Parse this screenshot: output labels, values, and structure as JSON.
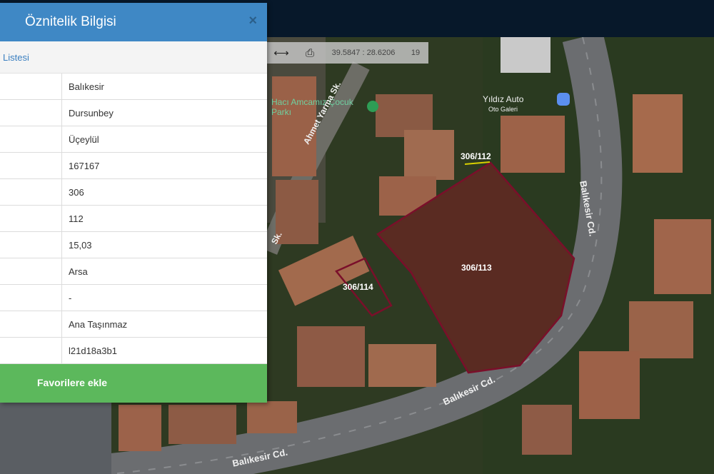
{
  "panel": {
    "title": "Öznitelik Bilgisi",
    "close_symbol": "×",
    "list_link": "Listesi",
    "values": [
      "Balıkesir",
      "Dursunbey",
      "Üçeylül",
      "167167",
      "306",
      "112",
      "15,03",
      "Arsa",
      "-",
      "Ana Taşınmaz",
      "l21d18a3b1"
    ],
    "favorite_button": "Favorilere ekle"
  },
  "toolbar": {
    "measure_icon": "measure-icon",
    "print_icon": "print-icon",
    "coordinates": "39.5847 : 28.6206",
    "zoom": "19"
  },
  "map": {
    "parcels": [
      "306/112",
      "306/113",
      "306/114"
    ],
    "street_labels": [
      "Ahmet Yarma Sk.",
      "Sk.",
      "Balıkesir Cd.",
      "Balıkesir Cd.",
      "Balıkesir Cd."
    ],
    "poi_labels": [
      "Hacı Amcamız Çocuk Parkı",
      "Yıldız Auto",
      "Oto Galeri"
    ]
  },
  "colors": {
    "header_blue": "#3f88c5",
    "favorite_green": "#5cb85c",
    "parcel_outline": "#7a0f2a"
  }
}
